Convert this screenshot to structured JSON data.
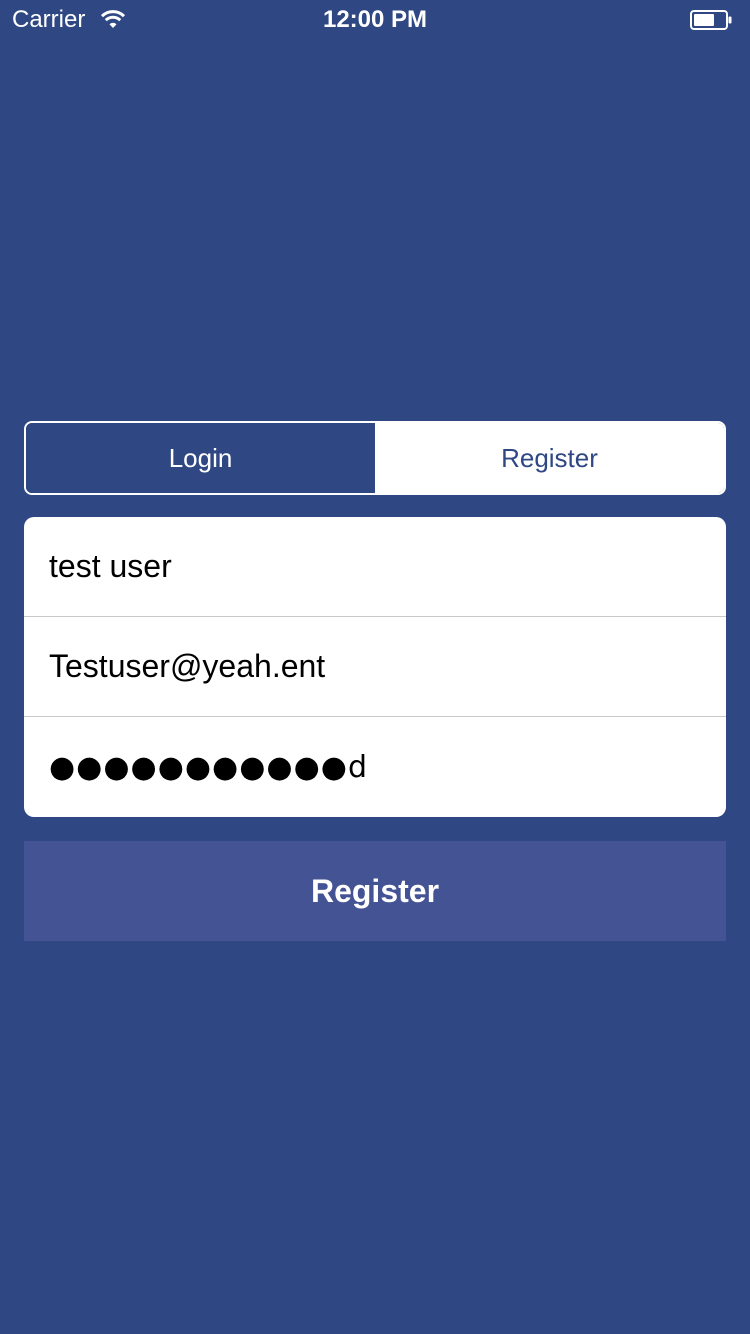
{
  "status_bar": {
    "carrier": "Carrier",
    "time": "12:00 PM",
    "wifi_icon": "wifi-icon",
    "battery_icon": "battery-icon"
  },
  "tabs": {
    "login_label": "Login",
    "register_label": "Register",
    "selected": "Register"
  },
  "form": {
    "username_value": "test user",
    "email_value": "Testuser@yeah.ent",
    "password_display": "●●●●●●●●●●●d"
  },
  "actions": {
    "submit_label": "Register"
  },
  "colors": {
    "background": "#2f4884",
    "button": "#435393",
    "card": "#ffffff"
  }
}
